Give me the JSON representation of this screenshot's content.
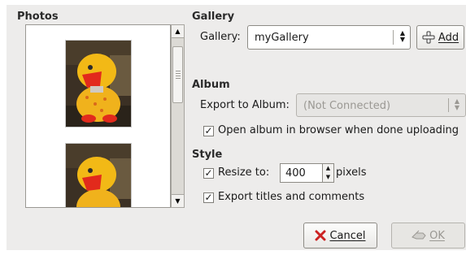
{
  "photos": {
    "title": "Photos"
  },
  "gallery": {
    "title": "Gallery",
    "label": "Gallery:",
    "value": "myGallery",
    "add_button": "Add",
    "add_mnemonic": "A"
  },
  "album": {
    "title": "Album",
    "label": "Export to Album:",
    "value": "(Not Connected)",
    "open_browser_label": "Open album in browser when done uploading",
    "open_browser_checked": true
  },
  "style": {
    "title": "Style",
    "resize_label": "Resize to:",
    "resize_checked": true,
    "resize_value": "400",
    "resize_unit": "pixels",
    "export_titles_label": "Export titles and comments",
    "export_titles_checked": true
  },
  "buttons": {
    "cancel": "Cancel",
    "ok": "OK"
  },
  "icons": {
    "add": "plus-icon",
    "cancel": "red-x-icon",
    "ok": "ok-icon",
    "checkmark": "checkmark-icon",
    "scroll_up": "arrow-up-icon",
    "scroll_down": "arrow-down-icon",
    "combo": "updown-arrows-icon"
  },
  "colors": {
    "panel_bg": "#edeceb",
    "cancel_icon": "#cc2222",
    "plus_icon": "#3a3a3a"
  }
}
